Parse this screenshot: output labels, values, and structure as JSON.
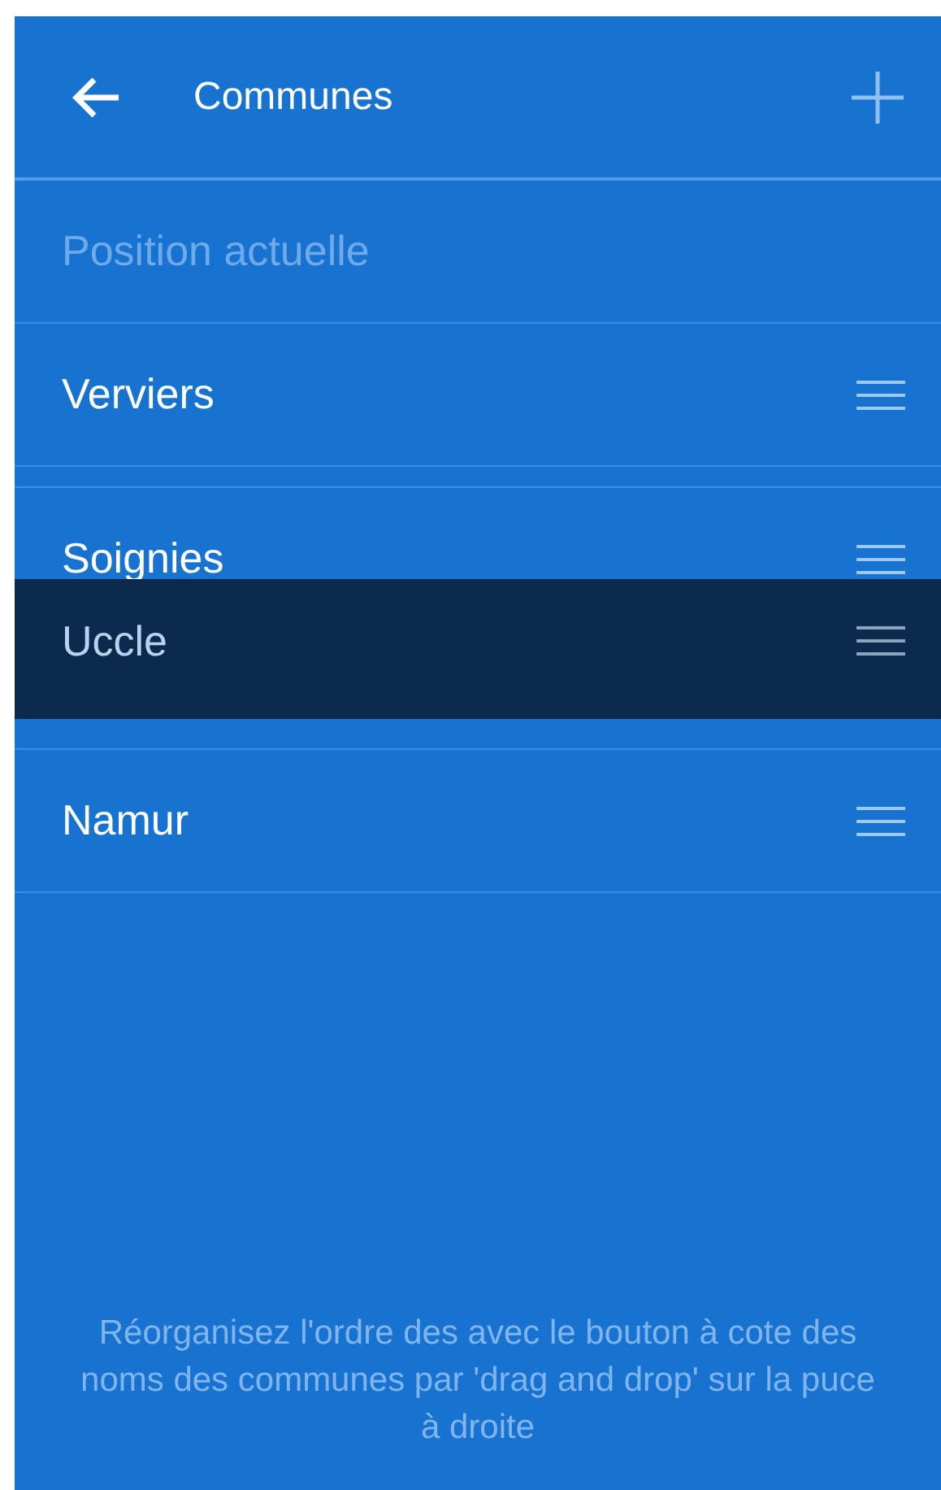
{
  "header": {
    "title": "Communes"
  },
  "current_position": {
    "label": "Position actuelle",
    "disabled": true
  },
  "communes": [
    {
      "name": "Verviers",
      "kind": "row"
    },
    {
      "kind": "gap"
    },
    {
      "name": "Soignies",
      "kind": "row"
    },
    {
      "kind": "slot"
    },
    {
      "name": "Namur",
      "kind": "row"
    }
  ],
  "dragged_item": {
    "name": "Uccle"
  },
  "hint": "Réorganisez l'ordre des avec le bouton à cote des noms des communes par 'drag and drop' sur la puce à droite"
}
